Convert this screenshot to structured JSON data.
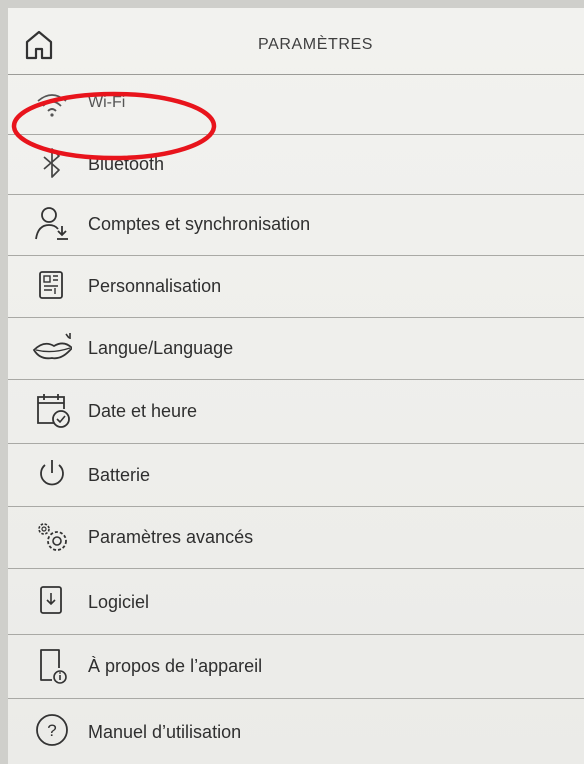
{
  "header": {
    "title": "PARAMÈTRES",
    "home_icon": "home-icon"
  },
  "items": [
    {
      "label": "Wi-Fi",
      "icon": "wifi-icon"
    },
    {
      "label": "Bluetooth",
      "icon": "bluetooth-icon"
    },
    {
      "label": "Comptes et synchronisation",
      "icon": "account-sync-icon"
    },
    {
      "label": "Personnalisation",
      "icon": "personalization-icon"
    },
    {
      "label": "Langue/Language",
      "icon": "language-lips-icon"
    },
    {
      "label": "Date et heure",
      "icon": "calendar-clock-icon"
    },
    {
      "label": "Batterie",
      "icon": "power-icon"
    },
    {
      "label": "Paramètres avancés",
      "icon": "gears-icon"
    },
    {
      "label": "Logiciel",
      "icon": "software-download-icon"
    },
    {
      "label": "À propos de l’appareil",
      "icon": "device-info-icon"
    },
    {
      "label": "Manuel d’utilisation",
      "icon": "help-icon"
    }
  ],
  "annotation": {
    "shape": "ellipse",
    "color": "#e8141c",
    "target": "Wi-Fi"
  }
}
